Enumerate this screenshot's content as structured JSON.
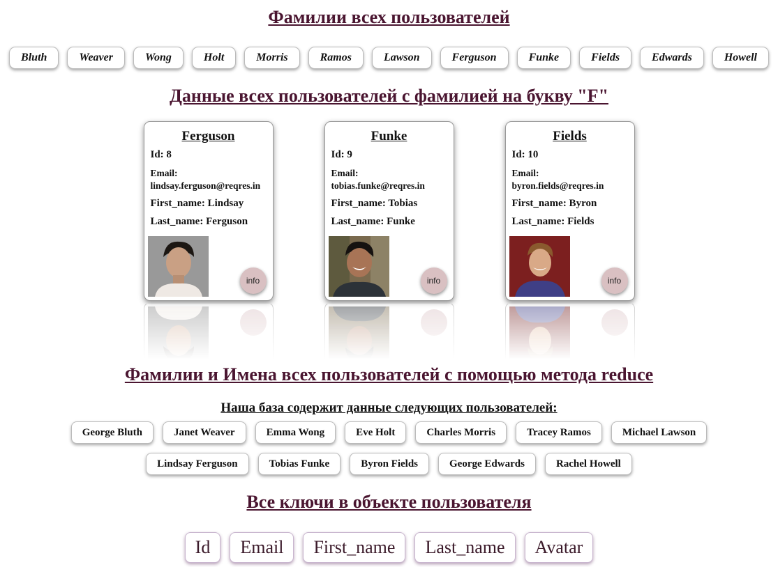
{
  "headings": {
    "surnames": "Фамилии всех пользователей",
    "f_users": "Данные всех пользователей с фамилией на букву \"F\"",
    "reduce": "Фамилии и Имена всех пользователей с помощью метода reduce",
    "db_caption": "Наша база содержит данные следующих пользователей:",
    "keys": "Все ключи в объекте пользователя"
  },
  "surnames": [
    "Bluth",
    "Weaver",
    "Wong",
    "Holt",
    "Morris",
    "Ramos",
    "Lawson",
    "Ferguson",
    "Funke",
    "Fields",
    "Edwards",
    "Howell"
  ],
  "cards": [
    {
      "title": "Ferguson",
      "id": "Id: 8",
      "email_label": "Email:",
      "email": "lindsay.ferguson@reqres.in",
      "first_name": "First_name: Lindsay",
      "last_name": "Last_name: Ferguson",
      "info": "info"
    },
    {
      "title": "Funke",
      "id": "Id: 9",
      "email_label": "Email:",
      "email": "tobias.funke@reqres.in",
      "first_name": "First_name: Tobias",
      "last_name": "Last_name: Funke",
      "info": "info"
    },
    {
      "title": "Fields",
      "id": "Id: 10",
      "email_label": "Email:",
      "email": "byron.fields@reqres.in",
      "first_name": "First_name: Byron",
      "last_name": "Last_name: Fields",
      "info": "info"
    }
  ],
  "full_names_row1": [
    "George Bluth",
    "Janet Weaver",
    "Emma Wong",
    "Eve Holt",
    "Charles Morris",
    "Tracey Ramos",
    "Michael Lawson"
  ],
  "full_names_row2": [
    "Lindsay Ferguson",
    "Tobias Funke",
    "Byron Fields",
    "George Edwards",
    "Rachel Howell"
  ],
  "keys": [
    "Id",
    "Email",
    "First_name",
    "Last_name",
    "Avatar"
  ],
  "colors": {
    "heading": "#4a1530",
    "info_button": "#d9c0c2",
    "key_border": "#c9b6cf"
  }
}
